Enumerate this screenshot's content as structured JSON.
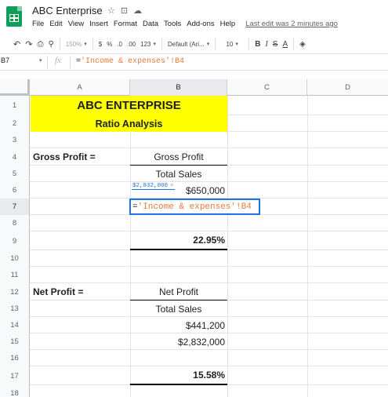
{
  "app": {
    "title": "ABC Enterprise",
    "menu": [
      "File",
      "Edit",
      "View",
      "Insert",
      "Format",
      "Data",
      "Tools",
      "Add-ons",
      "Help"
    ],
    "last_edit": "Last edit was 2 minutes ago"
  },
  "toolbar": {
    "zoom": "150%",
    "currency": "$",
    "percent": "%",
    "decimal_less": ".0",
    "decimal_more": ".00",
    "format_more": "123",
    "font": "Default (Ari...",
    "font_size": "10",
    "bold": "B",
    "italic": "I",
    "strike": "S",
    "text_color": "A"
  },
  "formula_bar": {
    "name_box": "B7",
    "fx": "fx",
    "eq": "=",
    "formula_ref": "'Income & expenses'!B4"
  },
  "columns": [
    "A",
    "B",
    "C",
    "D"
  ],
  "rows": [
    "1",
    "2",
    "3",
    "4",
    "5",
    "6",
    "7",
    "8",
    "9",
    "10",
    "11",
    "12",
    "13",
    "14",
    "15",
    "16",
    "17",
    "18"
  ],
  "sheet": {
    "title": "ABC ENTERPRISE",
    "subtitle": "Ratio Analysis",
    "gross_label": "Gross Profit =",
    "gross_num_label": "Gross Profit",
    "gross_den_label": "Total Sales",
    "gross_value": "$650,000",
    "gross_tooltip": "$2,832,000",
    "gross_tooltip_x": "×",
    "active_eq": "=",
    "active_ref": "'Income & expenses'!B4",
    "gross_ratio": "22.95%",
    "net_label": "Net Profit =",
    "net_num_label": "Net Profit",
    "net_den_label": "Total Sales",
    "net_profit_value": "$441,200",
    "net_sales_value": "$2,832,000",
    "net_ratio": "15.58%"
  },
  "colors": {
    "highlight": "#ffff00",
    "selection": "#1a73e8",
    "formula_text": "#e37a3b",
    "brand": "#0f9d58"
  }
}
